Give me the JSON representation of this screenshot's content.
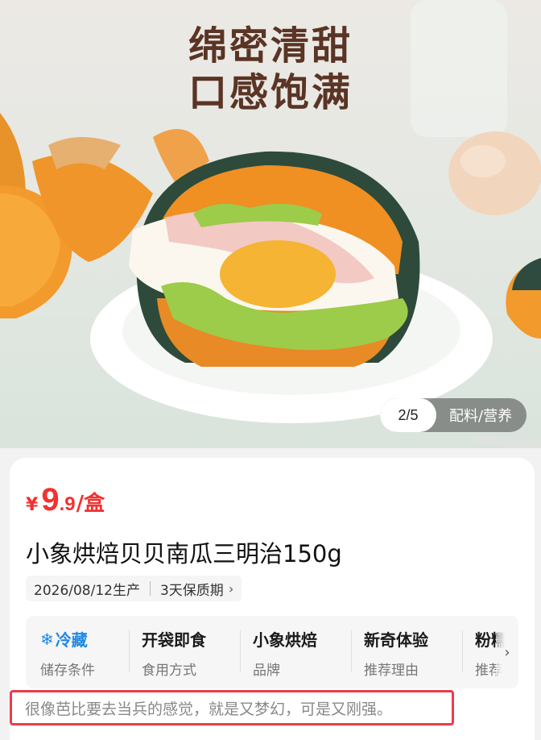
{
  "hero": {
    "headline_line1": "绵密清甜",
    "headline_line2": "口感饱满",
    "pager_count": "2/5",
    "pager_info": "配料/营养"
  },
  "product": {
    "price": {
      "currency": "¥",
      "integer": "9",
      "decimal": ".9",
      "unit": "/盒"
    },
    "title": "小象烘焙贝贝南瓜三明治150g",
    "production_date": "2026/08/12生产",
    "shelf_life": "3天保质期",
    "attributes": [
      {
        "value": "冷藏",
        "label": "储存条件",
        "icon": "snowflake-icon"
      },
      {
        "value": "开袋即食",
        "label": "食用方式"
      },
      {
        "value": "小象烘焙",
        "label": "品牌"
      },
      {
        "value": "新奇体验",
        "label": "推荐理由"
      },
      {
        "value": "粉糯",
        "label": "推荐"
      }
    ],
    "quote": "很像芭比要去当兵的感觉，就是又梦幻，可是又刚强。"
  },
  "colors": {
    "price_red": "#f23131",
    "highlight_border": "#ef3b4a",
    "cold_blue": "#1e88e5",
    "headline_brown": "#5a3424"
  }
}
